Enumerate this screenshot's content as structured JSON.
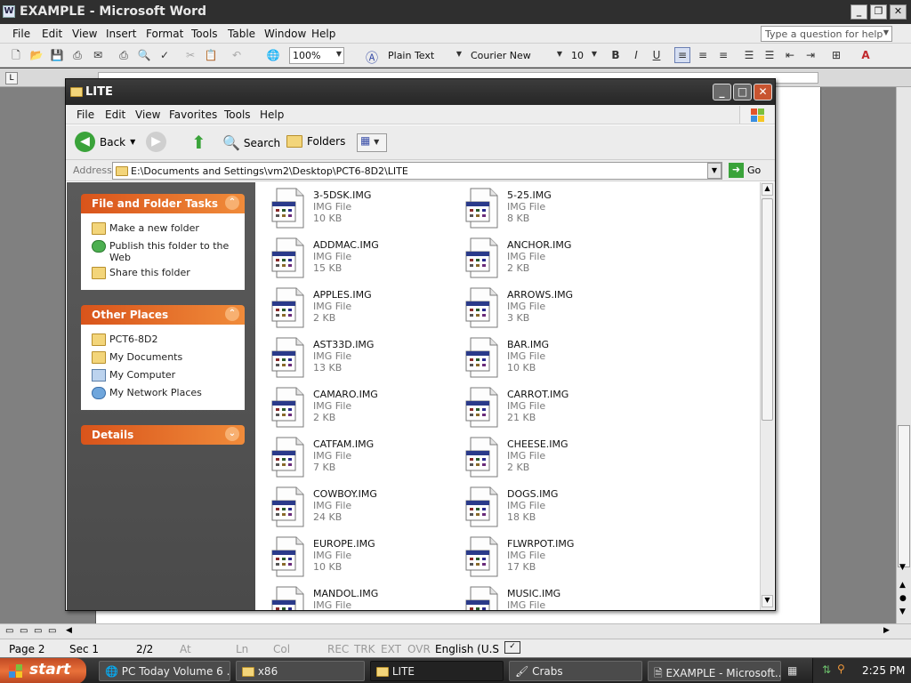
{
  "word": {
    "title": "EXAMPLE - Microsoft Word",
    "menu": [
      "File",
      "Edit",
      "View",
      "Insert",
      "Format",
      "Tools",
      "Table",
      "Window",
      "Help"
    ],
    "help_placeholder": "Type a question for help",
    "zoom": "100%",
    "style": "Plain Text",
    "font": "Courier New",
    "font_size": "10",
    "status": {
      "page": "Page  2",
      "sec": "Sec  1",
      "pages": "2/2",
      "at": "At",
      "ln": "Ln",
      "col": "Col",
      "rec": "REC",
      "trk": "TRK",
      "ext": "EXT",
      "ovr": "OVR",
      "lang": "English (U.S"
    }
  },
  "explorer": {
    "title": "LITE",
    "menu": [
      "File",
      "Edit",
      "View",
      "Favorites",
      "Tools",
      "Help"
    ],
    "toolbar": {
      "back": "Back",
      "search": "Search",
      "folders": "Folders"
    },
    "address_label": "Address",
    "address": "E:\\Documents and Settings\\vm2\\Desktop\\PCT6-8D2\\LITE",
    "go": "Go",
    "tasks": {
      "title": "File and Folder Tasks",
      "items": [
        "Make a new folder",
        "Publish this folder to the Web",
        "Share this folder"
      ]
    },
    "other_places": {
      "title": "Other Places",
      "items": [
        "PCT6-8D2",
        "My Documents",
        "My Computer",
        "My Network Places"
      ]
    },
    "details": {
      "title": "Details"
    },
    "files": [
      {
        "name": "3-5DSK.IMG",
        "type": "IMG File",
        "size": "10 KB"
      },
      {
        "name": "5-25.IMG",
        "type": "IMG File",
        "size": "8 KB"
      },
      {
        "name": "ADDMAC.IMG",
        "type": "IMG File",
        "size": "15 KB"
      },
      {
        "name": "ANCHOR.IMG",
        "type": "IMG File",
        "size": "2 KB"
      },
      {
        "name": "APPLES.IMG",
        "type": "IMG File",
        "size": "2 KB"
      },
      {
        "name": "ARROWS.IMG",
        "type": "IMG File",
        "size": "3 KB"
      },
      {
        "name": "AST33D.IMG",
        "type": "IMG File",
        "size": "13 KB"
      },
      {
        "name": "BAR.IMG",
        "type": "IMG File",
        "size": "10 KB"
      },
      {
        "name": "CAMARO.IMG",
        "type": "IMG File",
        "size": "2 KB"
      },
      {
        "name": "CARROT.IMG",
        "type": "IMG File",
        "size": "21 KB"
      },
      {
        "name": "CATFAM.IMG",
        "type": "IMG File",
        "size": "7 KB"
      },
      {
        "name": "CHEESE.IMG",
        "type": "IMG File",
        "size": "2 KB"
      },
      {
        "name": "COWBOY.IMG",
        "type": "IMG File",
        "size": "24 KB"
      },
      {
        "name": "DOGS.IMG",
        "type": "IMG File",
        "size": "18 KB"
      },
      {
        "name": "EUROPE.IMG",
        "type": "IMG File",
        "size": "10 KB"
      },
      {
        "name": "FLWRPOT.IMG",
        "type": "IMG File",
        "size": "17 KB"
      },
      {
        "name": "MANDOL.IMG",
        "type": "IMG File",
        "size": ""
      },
      {
        "name": "MUSIC.IMG",
        "type": "IMG File",
        "size": ""
      }
    ]
  },
  "taskbar": {
    "start": "start",
    "tasks": [
      "PC Today Volume 6 ...",
      "x86",
      "LITE",
      "Crabs",
      "EXAMPLE - Microsoft..."
    ],
    "clock": "2:25 PM"
  }
}
